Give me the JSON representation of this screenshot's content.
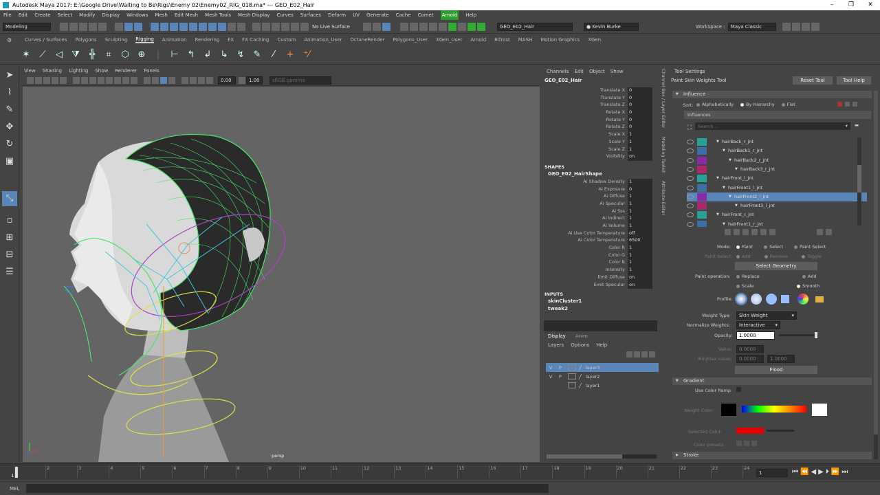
{
  "window": {
    "title": "Autodesk Maya 2017: E:\\Google Drive\\Waiting to Be\\Rigs\\Enemy 02\\Enemy02_RIG_018.ma*  ---  GEO_E02_Hair"
  },
  "menubar": [
    "File",
    "Edit",
    "Create",
    "Select",
    "Modify",
    "Display",
    "Windows",
    "Mesh",
    "Edit Mesh",
    "Mesh Tools",
    "Mesh Display",
    "Curves",
    "Surfaces",
    "Deform",
    "UV",
    "Generate",
    "Cache",
    "Comet",
    "Arnold",
    "Help"
  ],
  "menubar_highlight": "Arnold",
  "statusline": {
    "mode": "Modeling",
    "live_surface": "No Live Surface",
    "object_name": "GEO_E02_Hair",
    "user": "Kevin Burke",
    "workspace_label": "Workspace :",
    "workspace": "Maya Classic"
  },
  "shelf_tabs": [
    "Curves / Surfaces",
    "Polygons",
    "Sculpting",
    "Rigging",
    "Animation",
    "Rendering",
    "FX",
    "FX Caching",
    "Custom",
    "Animation_User",
    "OctaneRender",
    "Polygons_User",
    "XGen_User",
    "Arnold",
    "Bifrost",
    "MASH",
    "Motion Graphics",
    "XGen"
  ],
  "shelf_active": "Rigging",
  "viewport": {
    "menus": [
      "View",
      "Shading",
      "Lighting",
      "Show",
      "Renderer",
      "Panels"
    ],
    "exposure": "0.00",
    "gamma": "1.00",
    "color_space": "sRGB gamma",
    "camera": "persp"
  },
  "channel_box": {
    "menus": [
      "Channels",
      "Edit",
      "Object",
      "Show"
    ],
    "object": "GEO_E02_Hair",
    "transforms": [
      {
        "name": "Translate X",
        "value": "0"
      },
      {
        "name": "Translate Y",
        "value": "0"
      },
      {
        "name": "Translate Z",
        "value": "0"
      },
      {
        "name": "Rotate X",
        "value": "0"
      },
      {
        "name": "Rotate Y",
        "value": "0"
      },
      {
        "name": "Rotate Z",
        "value": "0"
      },
      {
        "name": "Scale X",
        "value": "1"
      },
      {
        "name": "Scale Y",
        "value": "1"
      },
      {
        "name": "Scale Z",
        "value": "1"
      },
      {
        "name": "Visibility",
        "value": "on"
      }
    ],
    "shapes_header": "SHAPES",
    "shape_name": "GEO_E02_HairShape",
    "shape_attrs": [
      {
        "name": "Ai Shadow Density",
        "value": "1"
      },
      {
        "name": "Ai Exposure",
        "value": "0"
      },
      {
        "name": "Ai Diffuse",
        "value": "1"
      },
      {
        "name": "Ai Specular",
        "value": "1"
      },
      {
        "name": "Ai Sss",
        "value": "1"
      },
      {
        "name": "Ai Indirect",
        "value": "1"
      },
      {
        "name": "Ai Volume",
        "value": "1"
      },
      {
        "name": "Ai Use Color Temperature",
        "value": "off"
      },
      {
        "name": "Ai Color Temperature",
        "value": "6500"
      },
      {
        "name": "Color R",
        "value": "1"
      },
      {
        "name": "Color G",
        "value": "1"
      },
      {
        "name": "Color B",
        "value": "1"
      },
      {
        "name": "Intensity",
        "value": "1"
      },
      {
        "name": "Emit Diffuse",
        "value": "on"
      },
      {
        "name": "Emit Specular",
        "value": "on"
      }
    ],
    "inputs_header": "INPUTS",
    "inputs": [
      "skinCluster1",
      "tweak2"
    ]
  },
  "side_tabs": [
    "Channel Box / Layer Editor",
    "Modeling Toolkit",
    "Attribute Editor"
  ],
  "layer_editor": {
    "tabs": [
      "Display",
      "Anim"
    ],
    "menus": [
      "Layers",
      "Options",
      "Help"
    ],
    "layers": [
      {
        "v": "V",
        "p": "P",
        "name": "layer3",
        "selected": true
      },
      {
        "v": "V",
        "p": "P",
        "name": "layer2",
        "selected": false
      },
      {
        "v": "",
        "p": "",
        "name": "layer1",
        "selected": false
      }
    ]
  },
  "tool_settings": {
    "title": "Tool Settings",
    "tool_name": "Paint Skin Weights Tool",
    "reset": "Reset Tool",
    "help": "Tool Help",
    "influence_header": "Influence",
    "sort_label": "Sort:",
    "sort_options": [
      "Alphabetically",
      "By Hierarchy",
      "Flat"
    ],
    "sort_selected": "By Hierarchy",
    "influences_label": "Influences",
    "search_placeholder": "Search...",
    "influences": [
      {
        "name": "hairBack_r_jnt",
        "indent": 1,
        "color": "#2aa198",
        "selected": false
      },
      {
        "name": "hairBack1_r_jnt",
        "indent": 2,
        "color": "#3b6fa8",
        "selected": false
      },
      {
        "name": "hairBack2_r_jnt",
        "indent": 3,
        "color": "#8a2aa8",
        "selected": false
      },
      {
        "name": "hairBack3_r_jnt",
        "indent": 4,
        "color": "#a82a6a",
        "selected": false
      },
      {
        "name": "hairFront_l_jnt",
        "indent": 1,
        "color": "#2aa198",
        "selected": false
      },
      {
        "name": "hairFront1_l_jnt",
        "indent": 2,
        "color": "#3b6fa8",
        "selected": false
      },
      {
        "name": "hairFront2_l_jnt",
        "indent": 3,
        "color": "#8a2aa8",
        "selected": true
      },
      {
        "name": "hairFront3_l_jnt",
        "indent": 4,
        "color": "#a82a6a",
        "selected": false
      },
      {
        "name": "hairFront_r_jnt",
        "indent": 1,
        "color": "#2aa198",
        "selected": false
      },
      {
        "name": "hairFront1_r_jnt",
        "indent": 2,
        "color": "#3b6fa8",
        "selected": false
      }
    ],
    "mode_label": "Mode:",
    "mode_options": [
      "Paint",
      "Select",
      "Paint Select"
    ],
    "paint_select_label": "Paint Select:",
    "paint_select_options": [
      "Add",
      "Remove",
      "Toggle"
    ],
    "select_geometry": "Select Geometry",
    "paint_op_label": "Paint operation:",
    "paint_ops": [
      "Replace",
      "Add",
      "Scale",
      "Smooth"
    ],
    "paint_op_selected": "Smooth",
    "profile_label": "Profile:",
    "weight_type_label": "Weight Type:",
    "weight_type": "Skin Weight",
    "normalize_label": "Normalize Weights:",
    "normalize": "Interactive",
    "opacity_label": "Opacity:",
    "opacity": "1.0000",
    "opacity_level": 1.0,
    "value_label": "Value:",
    "value": "0.0000",
    "minmax_label": "Min/Max value:",
    "min": "0.0000",
    "max": "1.0000",
    "flood": "Flood",
    "gradient_header": "Gradient",
    "use_color_ramp": "Use Color Ramp",
    "weight_color_label": "Weight Color:",
    "selected_color_label": "Selected Color:",
    "color_presets_label": "Color presets:",
    "stroke_header": "Stroke"
  },
  "timeline": {
    "start": "1",
    "ticks": [
      "1",
      "2",
      "3",
      "4",
      "5",
      "6",
      "7",
      "8",
      "9",
      "10",
      "11",
      "12",
      "13",
      "14",
      "15",
      "16",
      "17",
      "18",
      "19",
      "20",
      "21",
      "22",
      "23",
      "24"
    ],
    "current_frame": "1"
  },
  "command_line": {
    "lang": "MEL"
  },
  "colors": {
    "accent": "#5a85b8",
    "bg": "#444444",
    "viewport": "#646464",
    "wire": "#4be36a",
    "selected_color": "#e00000"
  }
}
